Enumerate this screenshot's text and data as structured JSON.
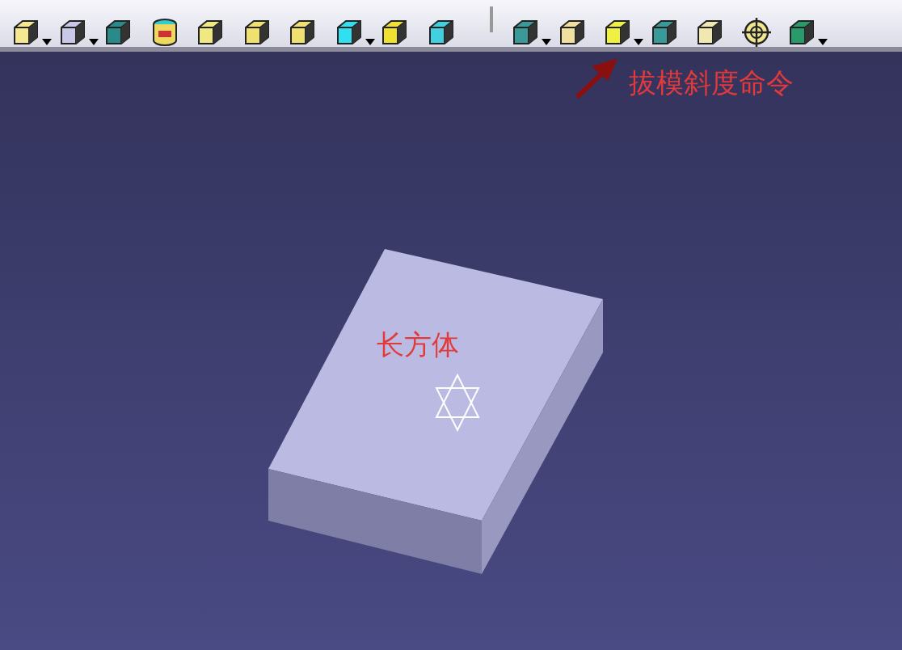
{
  "toolbar": {
    "groups": [
      {
        "tools": [
          {
            "dropdown": true
          },
          {
            "dropdown": true
          },
          {
            "dropdown": false
          },
          {
            "dropdown": false
          },
          {
            "dropdown": false
          },
          {
            "dropdown": false
          },
          {
            "dropdown": false
          },
          {
            "dropdown": true
          },
          {
            "dropdown": false
          },
          {
            "dropdown": false
          }
        ]
      },
      {
        "tools": [
          {
            "dropdown": true
          },
          {
            "dropdown": false
          },
          {
            "dropdown": true
          },
          {
            "dropdown": false
          },
          {
            "dropdown": false
          },
          {
            "dropdown": false
          },
          {
            "dropdown": true
          }
        ]
      }
    ]
  },
  "viewport": {
    "callout": "拔模斜度命令",
    "box_label": "长方体"
  }
}
